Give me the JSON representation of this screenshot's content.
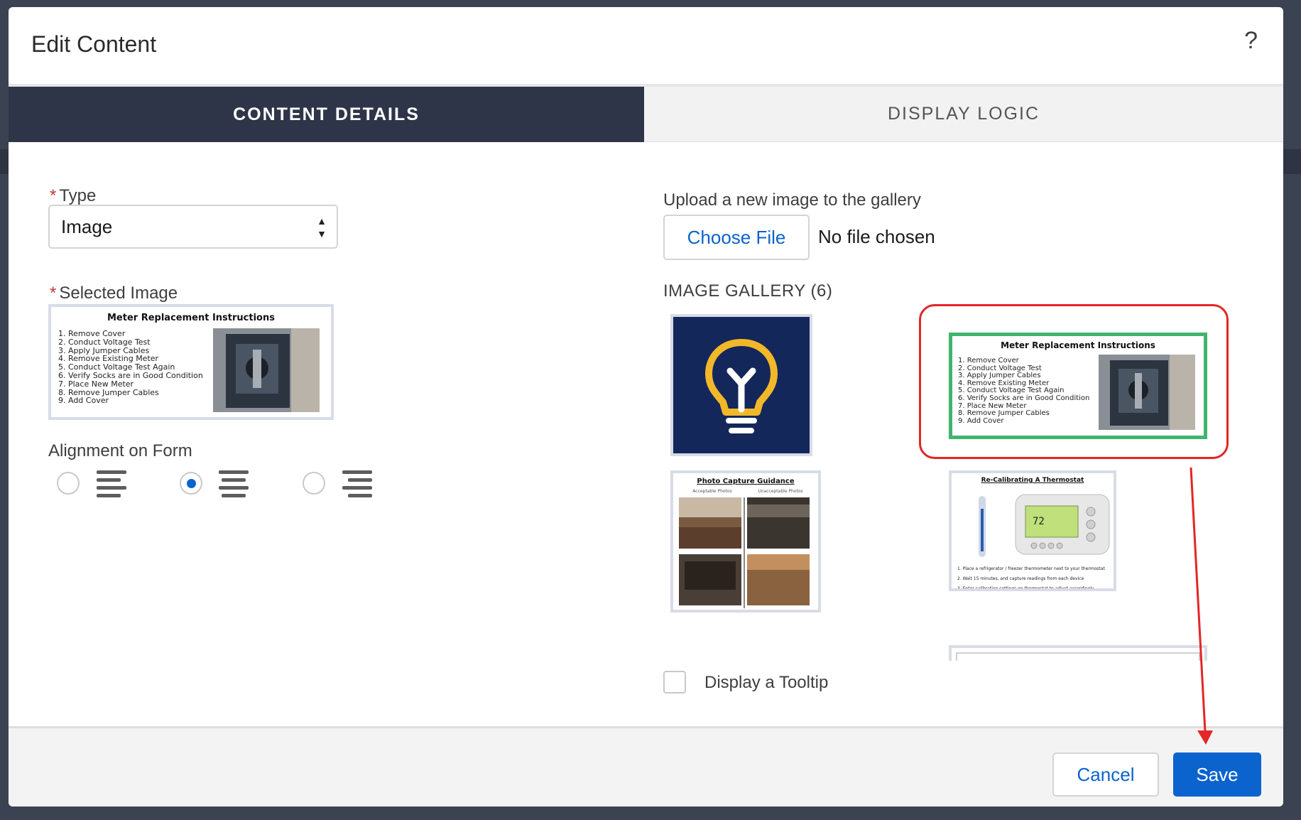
{
  "dialog": {
    "title": "Edit Content",
    "help_symbol": "?"
  },
  "tabs": [
    {
      "label": "CONTENT DETAILS",
      "active": true
    },
    {
      "label": "DISPLAY LOGIC",
      "active": false
    }
  ],
  "form": {
    "required_mark": "*",
    "type_label": "Type",
    "type_value": "Image",
    "selected_image_label": "Selected Image",
    "alignment_label": "Alignment on Form",
    "alignment_options": [
      "left",
      "center",
      "right"
    ],
    "alignment_selected": "center"
  },
  "upload": {
    "label": "Upload a new image to the gallery",
    "button_label": "Choose File",
    "status": "No file chosen"
  },
  "gallery": {
    "label": "IMAGE GALLERY (6)",
    "selected_index": 1,
    "meter": {
      "title": "Meter Replacement Instructions",
      "steps": [
        "1.  Remove Cover",
        "2.  Conduct Voltage Test",
        "3.  Apply Jumper Cables",
        "4.  Remove Existing Meter",
        "5.  Conduct Voltage Test Again",
        "6.  Verify Socks are in Good Condition",
        "7.  Place New Meter",
        "8.  Remove Jumper Cables",
        "9.  Add Cover"
      ]
    },
    "photo": {
      "title": "Photo Capture Guidance",
      "left_caption": "Acceptable Photos",
      "right_caption": "Unacceptable Photos"
    },
    "thermostat": {
      "title": "Re-Calibrating A Thermostat",
      "steps": [
        "1.  Place a refrigerator / freezer thermometer next to your thermostat",
        "2.  Wait 15 minutes, and capture readings from each device",
        "3.  Enter calibration settings on thermostat to adjust accordingly"
      ]
    }
  },
  "tooltip": {
    "label": "Display a Tooltip",
    "checked": false
  },
  "footer": {
    "cancel_label": "Cancel",
    "save_label": "Save"
  },
  "colors": {
    "brand_blue": "#0b63ce",
    "tab_dark": "#2e3548",
    "highlight_red": "#e32626",
    "selection_green": "#3fb56d",
    "bulb_bg": "#14275a",
    "bulb_yellow": "#f2b829"
  }
}
